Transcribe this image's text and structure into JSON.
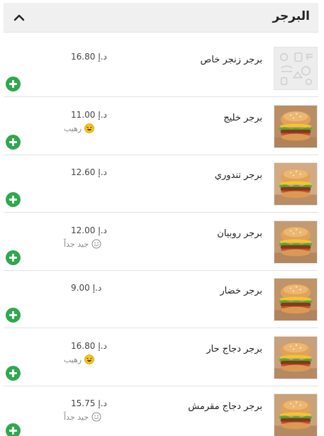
{
  "category": {
    "title": "البرجر",
    "toggle_icon": "chevron-up-icon"
  },
  "currency": "د.إ",
  "items": [
    {
      "name": "برجر زنجر خاص",
      "price": "16.80",
      "rating": "",
      "rating_icon": "",
      "image": "placeholder"
    },
    {
      "name": "برجر خليج",
      "price": "11.00",
      "rating": "رهيب",
      "rating_icon": "laughing-face-icon",
      "image": "burger"
    },
    {
      "name": "برجر تندوري",
      "price": "12.60",
      "rating": "",
      "rating_icon": "",
      "image": "burger"
    },
    {
      "name": "برجر روبيان",
      "price": "12.00",
      "rating": "جيد جداً",
      "rating_icon": "smiling-face-icon",
      "image": "burger"
    },
    {
      "name": "برجر خضار",
      "price": "9.00",
      "rating": "",
      "rating_icon": "",
      "image": "burger"
    },
    {
      "name": "برجر دجاج حار",
      "price": "16.80",
      "rating": "رهيب",
      "rating_icon": "laughing-face-icon",
      "image": "burger"
    },
    {
      "name": "برجر دجاج مقرمش",
      "price": "15.75",
      "rating": "جيد جداً",
      "rating_icon": "smiling-face-icon",
      "image": "burger"
    }
  ],
  "colors": {
    "add_button": "#2fa84f",
    "header_bg": "#f0f0f0",
    "rating_great": "#f5c518",
    "rating_good": "#888888"
  }
}
